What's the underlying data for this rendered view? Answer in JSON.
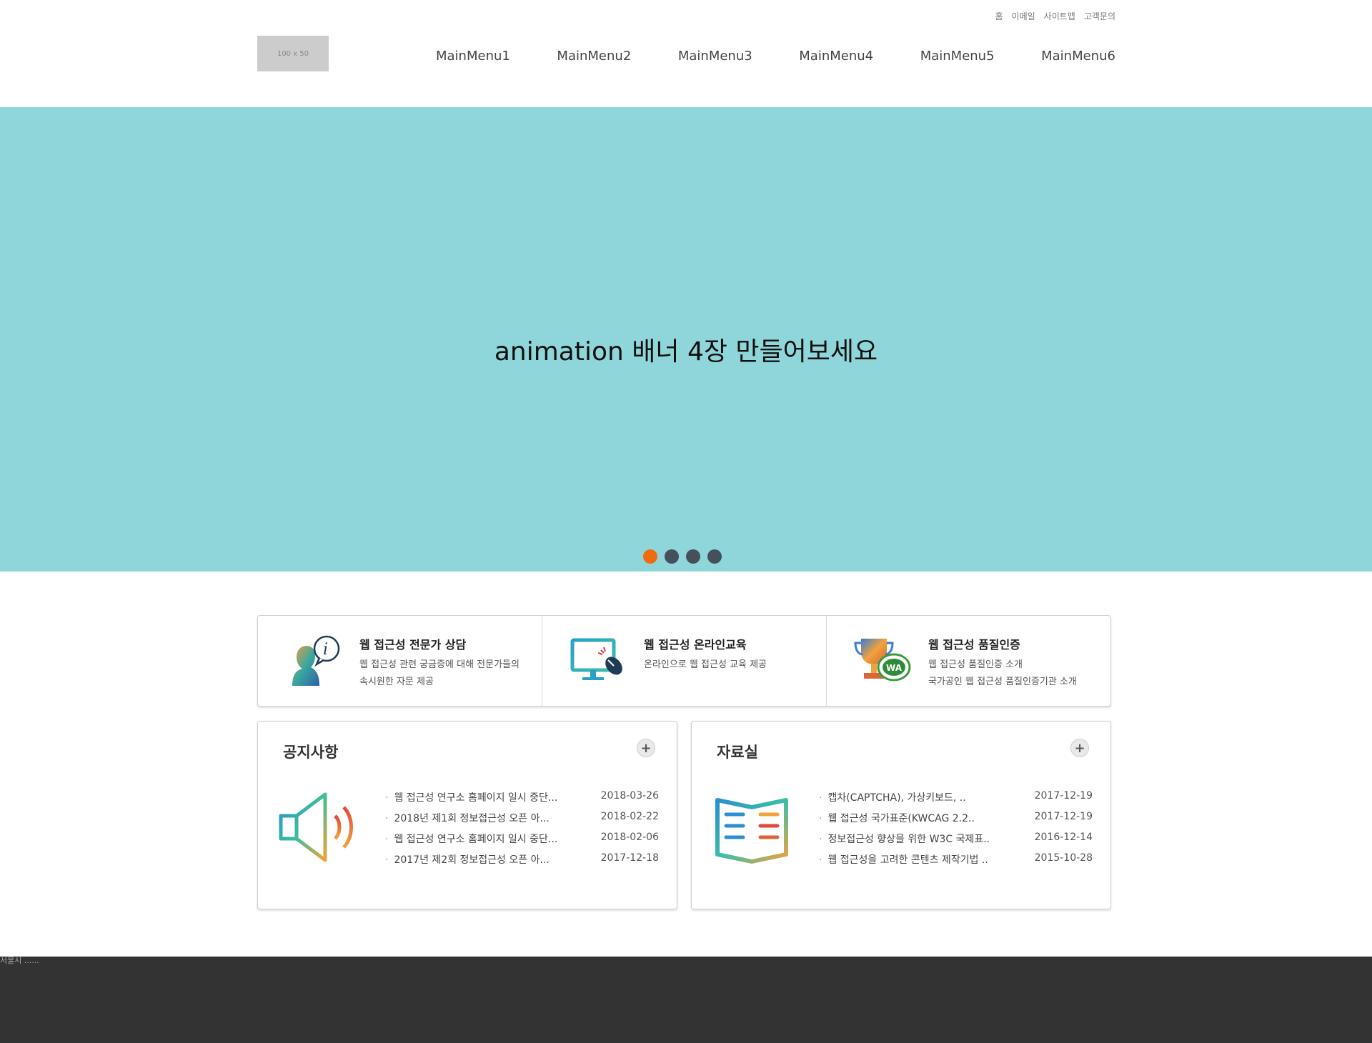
{
  "header": {
    "util_links": [
      "홈",
      "이메일",
      "사이트맵",
      "고객문의"
    ],
    "logo_text": "100 x 50",
    "menu": [
      "MainMenu1",
      "MainMenu2",
      "MainMenu3",
      "MainMenu4",
      "MainMenu5",
      "MainMenu6"
    ]
  },
  "banner": {
    "text": "animation 배너 4장 만들어보세요",
    "active_slide": 1,
    "slide_count": 4,
    "colors": {
      "background": "#8fd6da",
      "dot_active": "#f06b10",
      "dot": "#44515b"
    }
  },
  "services": [
    {
      "icon": "consultant-info-icon",
      "title": "웹 접근성 전문가 상담",
      "desc": "웹 접근성 관련 궁금증에 대해 전문가들의\n속시원한 자문 제공"
    },
    {
      "icon": "monitor-mouse-icon",
      "title": "웹 접근성 온라인교육",
      "desc": "온라인으로 웹 접근성 교육 제공"
    },
    {
      "icon": "trophy-wa-icon",
      "title": "웹 접근성 품질인증",
      "desc": "웹 접근성 품질인증 소개\n국가공인 웹 접근성 품질인증기관 소개"
    }
  ],
  "notice": {
    "title": "공지사항",
    "icon": "speaker-icon",
    "items": [
      {
        "title": "웹 접근성 연구소 홈페이지 일시 중단...",
        "date": "2018-03-26"
      },
      {
        "title": "2018년 제1회 정보접근성 오픈 아...",
        "date": "2018-02-22"
      },
      {
        "title": "웹 접근성 연구소 홈페이지 일시 중단...",
        "date": "2018-02-06"
      },
      {
        "title": "2017년 제2회 정보접근성 오픈 아...",
        "date": "2017-12-18"
      }
    ]
  },
  "archive": {
    "title": "자료실",
    "icon": "open-book-icon",
    "items": [
      {
        "title": "캡차(CAPTCHA), 가상키보드, ..",
        "date": "2017-12-19"
      },
      {
        "title": "웹 접근성 국가표준(KWCAG 2.2..",
        "date": "2017-12-19"
      },
      {
        "title": "정보접근성 향상을 위한 W3C 국제표..",
        "date": "2016-12-14"
      },
      {
        "title": "웹 접근성을 고려한 콘텐츠 제작기법 ..",
        "date": "2015-10-28"
      }
    ]
  },
  "footer": {
    "text": "서울시 ......"
  }
}
